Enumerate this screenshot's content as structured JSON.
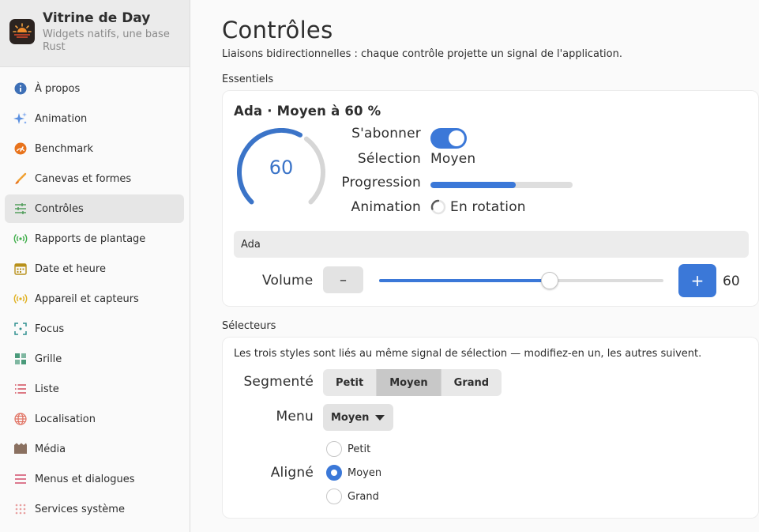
{
  "app": {
    "title": "Vitrine de Day",
    "subtitle": "Widgets natifs, une base Rust"
  },
  "sidebar": {
    "items": [
      {
        "label": "À propos",
        "icon": "info-icon",
        "color": "#3d6fb6"
      },
      {
        "label": "Animation",
        "icon": "sparkle-icon",
        "color": "#5a8fe0"
      },
      {
        "label": "Benchmark",
        "icon": "speedometer-icon",
        "color": "#e8731c"
      },
      {
        "label": "Canevas et formes",
        "icon": "brush-icon",
        "color": "#f0a030"
      },
      {
        "label": "Contrôles",
        "icon": "sliders-icon",
        "color": "#4a9a55"
      },
      {
        "label": "Rapports de plantage",
        "icon": "broadcast-icon",
        "color": "#3fae4a"
      },
      {
        "label": "Date et heure",
        "icon": "calendar-icon",
        "color": "#b8901a"
      },
      {
        "label": "Appareil et capteurs",
        "icon": "sensor-icon",
        "color": "#e0b020"
      },
      {
        "label": "Focus",
        "icon": "focus-icon",
        "color": "#2f8f8f"
      },
      {
        "label": "Grille",
        "icon": "grid-icon",
        "color": "#4a9a7a"
      },
      {
        "label": "Liste",
        "icon": "list-icon",
        "color": "#d04050"
      },
      {
        "label": "Localisation",
        "icon": "globe-icon",
        "color": "#e07060"
      },
      {
        "label": "Média",
        "icon": "film-icon",
        "color": "#8a7060"
      },
      {
        "label": "Menus et dialogues",
        "icon": "menu-icon",
        "color": "#d04060"
      },
      {
        "label": "Services système",
        "icon": "dots-grid-icon",
        "color": "#e07a7a"
      }
    ],
    "active_index": 4
  },
  "main": {
    "title": "Contrôles",
    "description": "Liaisons bidirectionnelles : chaque contrôle projette un signal de l'application.",
    "essentials": {
      "section_title": "Essentiels",
      "heading": "Ada · Moyen à 60 %",
      "gauge_value": "60",
      "gauge_fraction": 0.6,
      "subscribe_label": "S'abonner",
      "subscribe_on": true,
      "selection_label": "Sélection",
      "selection_value": "Moyen",
      "progress_label": "Progression",
      "progress_fraction": 0.6,
      "animation_label": "Animation",
      "animation_value": "En rotation",
      "entry_value": "Ada",
      "volume_label": "Volume",
      "minus_label": "–",
      "plus_label": "+",
      "volume_value": "60",
      "volume_fraction": 0.6
    },
    "selectors": {
      "section_title": "Sélecteurs",
      "description": "Les trois styles sont liés au même signal de sélection — modifiez-en un, les autres suivent.",
      "segmented_label": "Segmenté",
      "segments": [
        "Petit",
        "Moyen",
        "Grand"
      ],
      "selected_segment": 1,
      "menu_label": "Menu",
      "menu_value": "Moyen",
      "aligned_label": "Aligné",
      "radios": [
        "Petit",
        "Moyen",
        "Grand"
      ],
      "selected_radio": 1
    }
  },
  "colors": {
    "accent": "#3b78d8"
  }
}
